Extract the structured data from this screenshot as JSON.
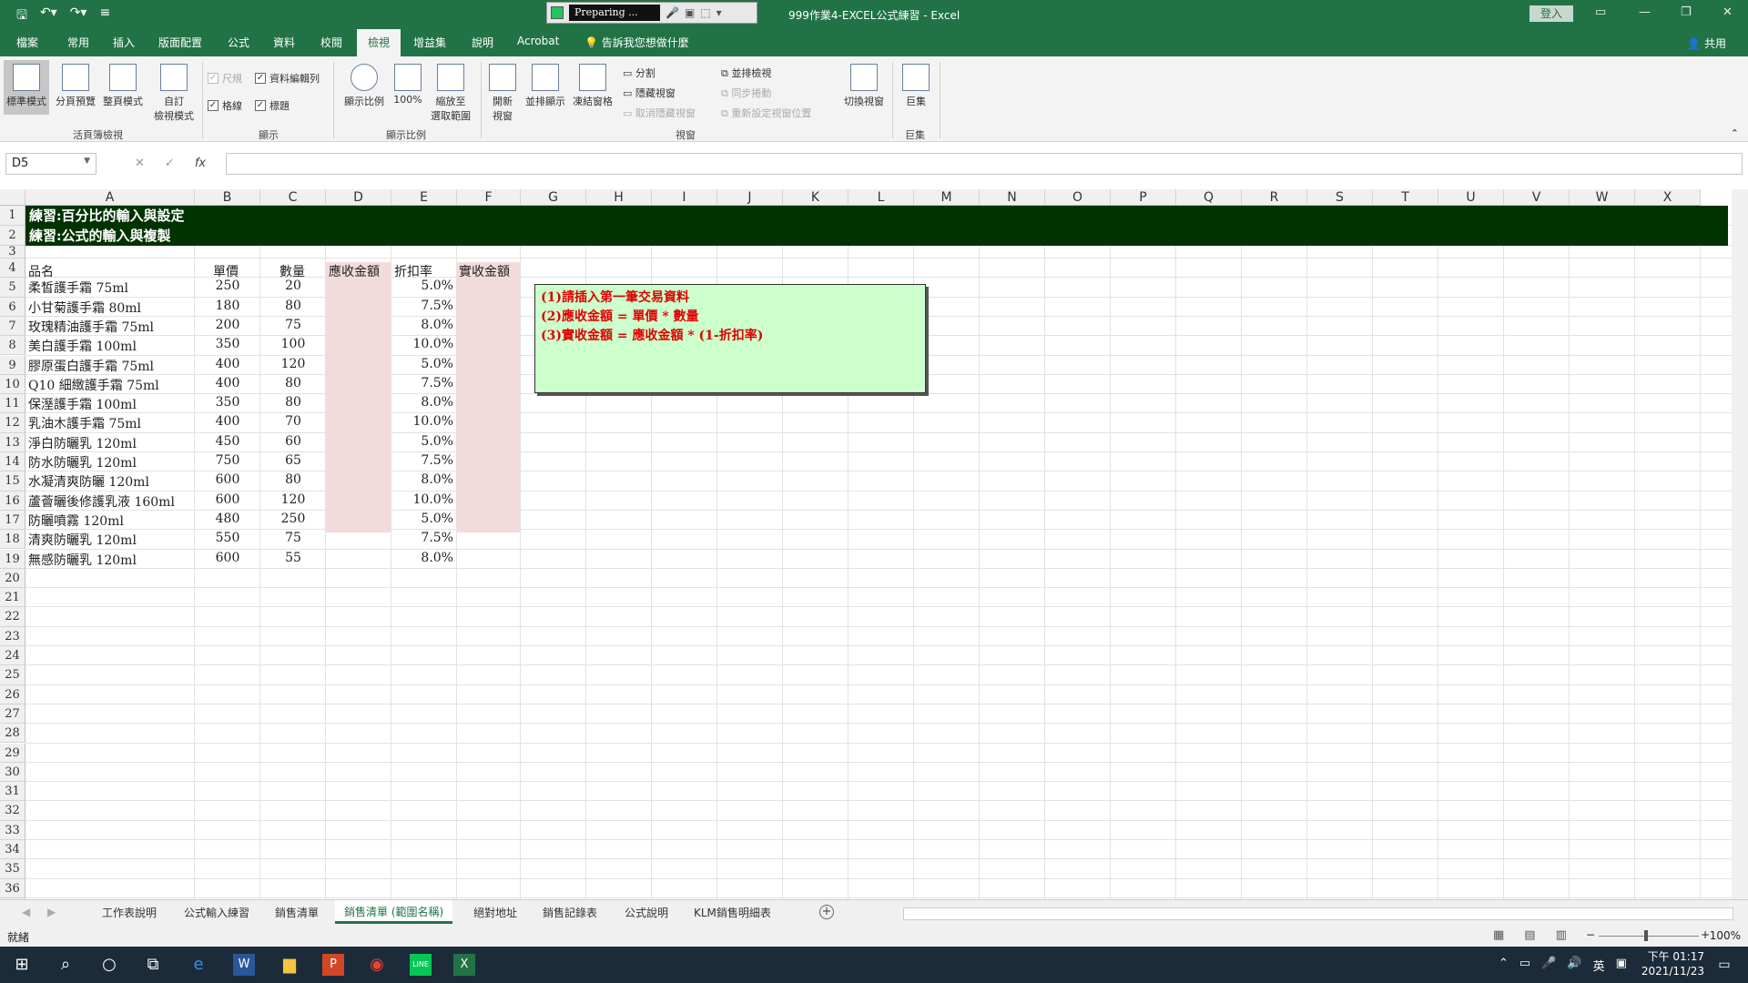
{
  "window": {
    "title": "999作業4-EXCEL公式練習 - Excel",
    "login_label": "登入",
    "recorder_status": "Preparing ...",
    "share_label": "共用"
  },
  "tabs": [
    "檔案",
    "常用",
    "插入",
    "版面配置",
    "公式",
    "資料",
    "校閱",
    "檢視",
    "增益集",
    "說明",
    "Acrobat"
  ],
  "active_tab": "檢視",
  "tell_me": "告訴我您想做什麼",
  "ribbon": {
    "workbook_views": [
      "標準模式",
      "分頁預覽",
      "整頁模式",
      "自訂\n檢視模式"
    ],
    "workbook_views_group": "活頁簿檢視",
    "show": {
      "ruler": "尺規",
      "formula_bar": "資料編輯列",
      "gridlines": "格線",
      "headings": "標題"
    },
    "show_group": "顯示",
    "zoom_buttons": [
      "顯示比例",
      "100%",
      "縮放至\n選取範圍"
    ],
    "zoom_group": "顯示比例",
    "window_buttons": [
      "開新\n視窗",
      "並排顯示",
      "凍結窗格"
    ],
    "window_small": [
      "分割",
      "隱藏視窗",
      "取消隱藏視窗"
    ],
    "window_small2": [
      "並排檢視",
      "同步捲動",
      "重新設定視窗位置"
    ],
    "switch_windows": "切換視窗",
    "window_group": "視窗",
    "macros": "巨集",
    "macros_group": "巨集"
  },
  "formula_bar": {
    "name_box": "D5",
    "fx": "fx",
    "value": ""
  },
  "columns": [
    "A",
    "B",
    "C",
    "D",
    "E",
    "F",
    "G",
    "H",
    "I",
    "J",
    "K",
    "L",
    "M",
    "N",
    "O",
    "P",
    "Q",
    "R",
    "S",
    "T",
    "U",
    "V",
    "W",
    "X"
  ],
  "banner": [
    "練習:百分比的輸入與設定",
    "練習:公式的輸入與複製"
  ],
  "headers": {
    "name": "品名",
    "price": "單價",
    "qty": "數量",
    "receivable": "應收金額",
    "discount": "折扣率",
    "actual": "實收金額"
  },
  "rows": [
    {
      "name": "柔皙護手霜 75ml",
      "price": "250",
      "qty": "20",
      "discount": "5.0%"
    },
    {
      "name": "小甘菊護手霜 80ml",
      "price": "180",
      "qty": "80",
      "discount": "7.5%"
    },
    {
      "name": "玫瑰精油護手霜 75ml",
      "price": "200",
      "qty": "75",
      "discount": "8.0%"
    },
    {
      "name": "美白護手霜 100ml",
      "price": "350",
      "qty": "100",
      "discount": "10.0%"
    },
    {
      "name": "膠原蛋白護手霜 75ml",
      "price": "400",
      "qty": "120",
      "discount": "5.0%"
    },
    {
      "name": "Q10 細緻護手霜 75ml",
      "price": "400",
      "qty": "80",
      "discount": "7.5%"
    },
    {
      "name": "保溼護手霜 100ml",
      "price": "350",
      "qty": "80",
      "discount": "8.0%"
    },
    {
      "name": "乳油木護手霜 75ml",
      "price": "400",
      "qty": "70",
      "discount": "10.0%"
    },
    {
      "name": "淨白防曬乳 120ml",
      "price": "450",
      "qty": "60",
      "discount": "5.0%"
    },
    {
      "name": "防水防曬乳 120ml",
      "price": "750",
      "qty": "65",
      "discount": "7.5%"
    },
    {
      "name": "水凝清爽防曬 120ml",
      "price": "600",
      "qty": "80",
      "discount": "8.0%"
    },
    {
      "name": "蘆薈曬後修護乳液 160ml",
      "price": "600",
      "qty": "120",
      "discount": "10.0%"
    },
    {
      "name": "防曬噴霧 120ml",
      "price": "480",
      "qty": "250",
      "discount": "5.0%"
    },
    {
      "name": "清爽防曬乳 120ml",
      "price": "550",
      "qty": "75",
      "discount": "7.5%"
    },
    {
      "name": "無感防曬乳 120ml",
      "price": "600",
      "qty": "55",
      "discount": "8.0%"
    }
  ],
  "note": [
    "(1)請插入第一筆交易資料",
    "(2)應收金額 = 單價 * 數量",
    "(3)實收金額 = 應收金額 * (1-折扣率)"
  ],
  "sheets": [
    "工作表說明",
    "公式輸入練習",
    "銷售清單",
    "銷售清單 (範圍名稱)",
    "絕對地址",
    "銷售記錄表",
    "公式說明",
    "KLM銷售明細表"
  ],
  "active_sheet": "銷售清單 (範圍名稱)",
  "status": {
    "ready": "就緒",
    "zoom": "100%"
  },
  "clock": {
    "time": "下午 01:17",
    "date": "2021/11/23"
  },
  "tray_lang": "英",
  "colors": {
    "excel_green": "#217346",
    "banner": "#003300",
    "pink": "#f2dcdb",
    "note_bg": "#ccffcc",
    "note_text": "#e00000"
  }
}
